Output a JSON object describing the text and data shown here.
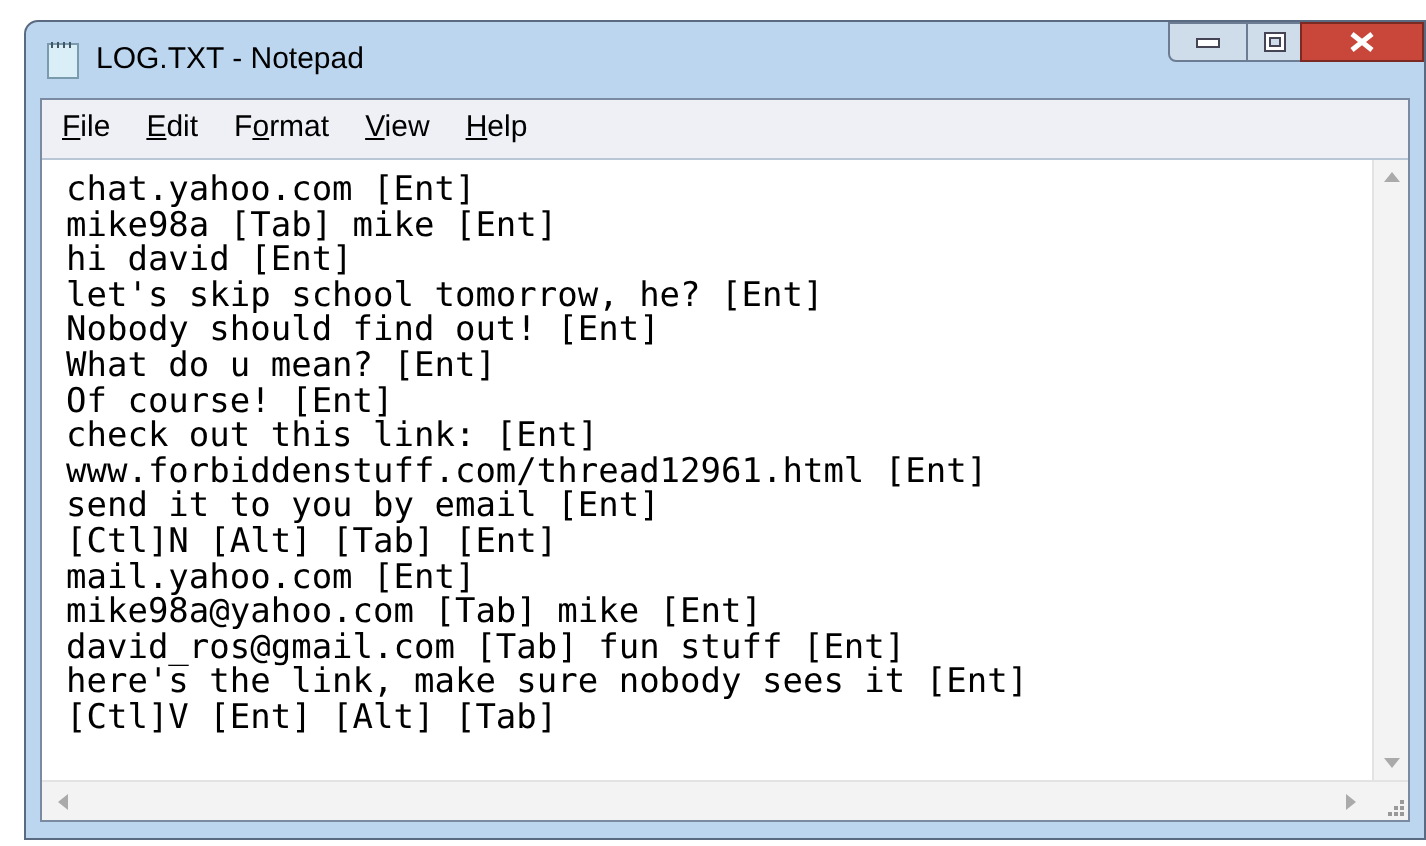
{
  "window": {
    "title": "LOG.TXT - Notepad"
  },
  "menu": [
    {
      "mnemonic": "F",
      "rest": "ile"
    },
    {
      "mnemonic": "E",
      "rest": "dit"
    },
    {
      "prefix": "F",
      "mnemonic": "o",
      "rest": "rmat"
    },
    {
      "mnemonic": "V",
      "rest": "iew"
    },
    {
      "mnemonic": "H",
      "rest": "elp"
    }
  ],
  "lines": [
    "chat.yahoo.com [Ent]",
    "mike98a [Tab] mike [Ent]",
    "hi david [Ent]",
    "let's skip school tomorrow, he? [Ent]",
    "Nobody should find out! [Ent]",
    "What do u mean? [Ent]",
    "Of course! [Ent]",
    "check out this link: [Ent]",
    "www.forbiddenstuff.com/thread12961.html [Ent]",
    "send it to you by email [Ent]",
    "[Ctl]N [Alt] [Tab] [Ent]",
    "mail.yahoo.com [Ent]",
    "mike98a@yahoo.com [Tab] mike [Ent]",
    "david_ros@gmail.com [Tab] fun stuff [Ent]",
    "here's the link, make sure nobody sees it [Ent]",
    "[Ctl]V [Ent] [Alt] [Tab]"
  ]
}
